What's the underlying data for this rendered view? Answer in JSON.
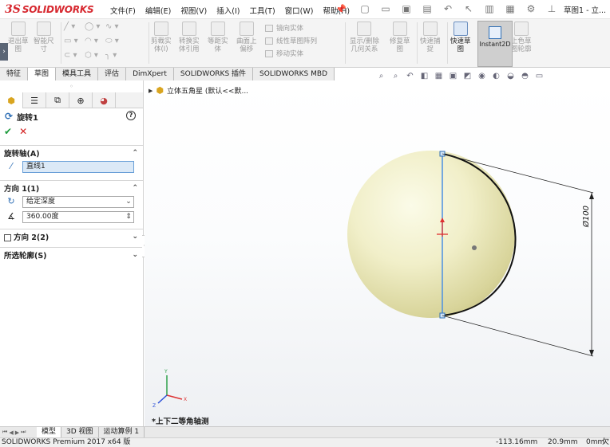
{
  "app": {
    "logo_ds": "3S",
    "logo_name": "SOLIDWORKS",
    "doc_title": "草图1 - 立..."
  },
  "menu": [
    "文件(F)",
    "编辑(E)",
    "视图(V)",
    "插入(I)",
    "工具(T)",
    "窗口(W)",
    "帮助(H)"
  ],
  "ribbon": {
    "btn_exit_sketch": "退出草\n图",
    "btn_smart_dim": "智能尺\n寸",
    "btn_trim": "剪裁实\n体(I)",
    "btn_convert": "转换实\n体引用",
    "btn_offset": "等距实\n体",
    "btn_surface_offset": "曲面上\n偏移",
    "list_mirror": "镜向实体",
    "list_linear": "线性草图阵列",
    "list_move": "移动实体",
    "btn_display_delete": "显示/删除\n几何关系",
    "btn_repair": "修复草\n图",
    "btn_quick_snaps": "快速捕\n捉",
    "btn_rapid_sketch": "快速草\n图",
    "btn_instant2d": "Instant2D",
    "btn_shaded_sketch": "上色草\n图轮廓"
  },
  "tabs": [
    "特征",
    "草图",
    "模具工具",
    "评估",
    "DimXpert",
    "SOLIDWORKS 插件",
    "SOLIDWORKS MBD"
  ],
  "panel": {
    "feature_title": "旋转1",
    "help": "?",
    "ok": "✔",
    "cancel": "✕",
    "axis_header": "旋转轴(A)",
    "axis_value": "直线1",
    "dir1_header": "方向 1(1)",
    "dir1_type": "给定深度",
    "dir1_angle": "360.00度",
    "dir2_header": "方向 2(2)",
    "contours_header": "所选轮廓(S)"
  },
  "tree": {
    "part_label": "立体五角星 (默认<<默..."
  },
  "view": {
    "view_name": "*上下二等角轴测",
    "dimension": "Ø100"
  },
  "bottom_tabs": [
    "模型",
    "3D 视图",
    "运动算例 1"
  ],
  "status": {
    "product": "SOLIDWORKS Premium 2017 x64 版",
    "x": "-113.16mm",
    "y": "20.9mm",
    "z": "0mm",
    "extra": "欠"
  },
  "colors": {
    "brand": "#d7282f",
    "ok": "#1e9b3d",
    "cancel": "#d32020",
    "axis_line": "#4a90e2",
    "sphere_highlight": "#fbfbe8",
    "sphere_shade": "#d8d49a",
    "selected_field": "#dbe9f7"
  }
}
